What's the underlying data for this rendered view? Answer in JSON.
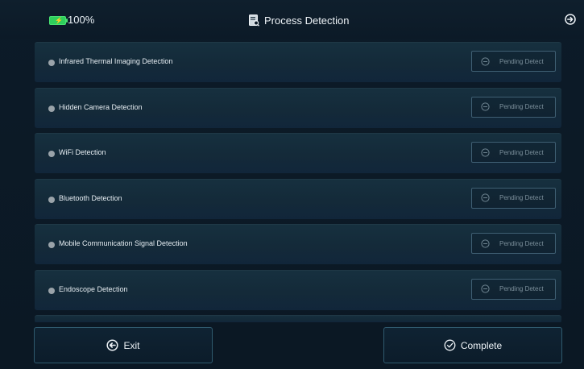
{
  "status_bar": {
    "battery_level": "100%",
    "battery_color": "#2fcf5c"
  },
  "header": {
    "title": "Process Detection",
    "title_icon": "document-scan-icon",
    "corner_icon": "arrow-circle-right-icon"
  },
  "detections": [
    {
      "label": "Infrared Thermal Imaging Detection",
      "status": "Pending Detect"
    },
    {
      "label": "Hidden Camera Detection",
      "status": "Pending Detect"
    },
    {
      "label": "WiFi Detection",
      "status": "Pending Detect"
    },
    {
      "label": "Bluetooth Detection",
      "status": "Pending Detect"
    },
    {
      "label": "Mobile Communication Signal Detection",
      "status": "Pending Detect"
    },
    {
      "label": "Endoscope Detection",
      "status": "Pending Detect"
    }
  ],
  "footer": {
    "exit_label": "Exit",
    "complete_label": "Complete"
  }
}
